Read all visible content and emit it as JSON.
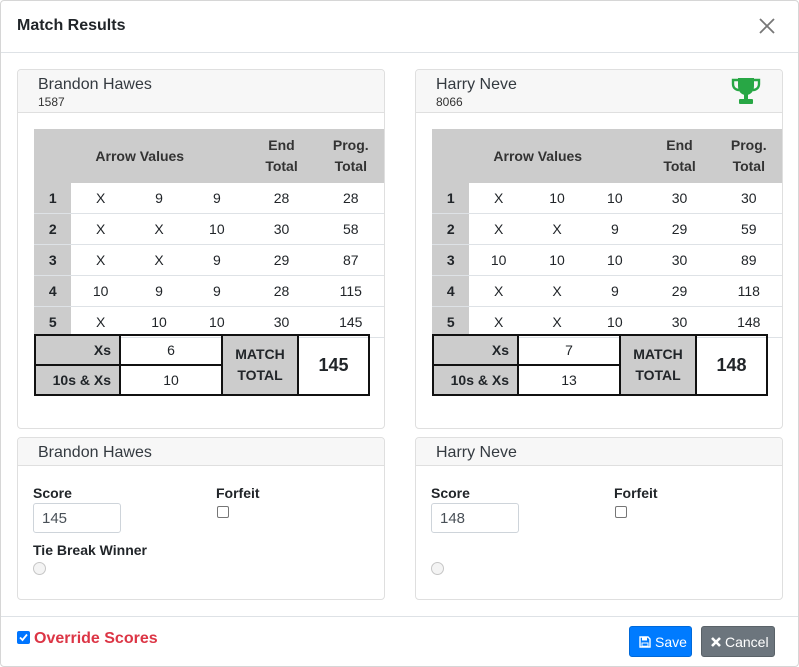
{
  "modal": {
    "title": "Match Results"
  },
  "scorecard_header": {
    "arrow_values": "Arrow Values",
    "end_total_1": "End",
    "end_total_2": "Total",
    "prog_total_1": "Prog.",
    "prog_total_2": "Total"
  },
  "summary_labels": {
    "xs": "Xs",
    "tens": "10s & Xs",
    "match_1": "MATCH",
    "match_2": "TOTAL"
  },
  "players": [
    {
      "name": "Brandon Hawes",
      "id": "1587",
      "winner": false,
      "ends": [
        {
          "n": "1",
          "a": [
            "X",
            "9",
            "9"
          ],
          "end": "28",
          "prog": "28"
        },
        {
          "n": "2",
          "a": [
            "X",
            "X",
            "10"
          ],
          "end": "30",
          "prog": "58"
        },
        {
          "n": "3",
          "a": [
            "X",
            "X",
            "9"
          ],
          "end": "29",
          "prog": "87"
        },
        {
          "n": "4",
          "a": [
            "10",
            "9",
            "9"
          ],
          "end": "28",
          "prog": "115"
        },
        {
          "n": "5",
          "a": [
            "X",
            "10",
            "10"
          ],
          "end": "30",
          "prog": "145"
        }
      ],
      "xs": "6",
      "tens": "10",
      "match_total": "145",
      "score": "145"
    },
    {
      "name": "Harry Neve",
      "id": "8066",
      "winner": true,
      "ends": [
        {
          "n": "1",
          "a": [
            "X",
            "10",
            "10"
          ],
          "end": "30",
          "prog": "30"
        },
        {
          "n": "2",
          "a": [
            "X",
            "X",
            "9"
          ],
          "end": "29",
          "prog": "59"
        },
        {
          "n": "3",
          "a": [
            "10",
            "10",
            "10"
          ],
          "end": "30",
          "prog": "89"
        },
        {
          "n": "4",
          "a": [
            "X",
            "X",
            "9"
          ],
          "end": "29",
          "prog": "118"
        },
        {
          "n": "5",
          "a": [
            "X",
            "X",
            "10"
          ],
          "end": "30",
          "prog": "148"
        }
      ],
      "xs": "7",
      "tens": "13",
      "match_total": "148",
      "score": "148"
    }
  ],
  "form": {
    "score_label": "Score",
    "forfeit_label": "Forfeit",
    "tie_break_label": "Tie Break Winner"
  },
  "footer": {
    "override_label": "Override Scores",
    "override_checked": true,
    "save_label": "Save",
    "cancel_label": "Cancel"
  },
  "colors": {
    "primary": "#007bff",
    "secondary": "#6c757d",
    "danger": "#dc3545",
    "trophy": "#28a745",
    "header_gray": "#cccccc"
  },
  "icons": {
    "close": "close-icon",
    "trophy": "trophy-icon",
    "save": "floppy-disk-icon",
    "cancel": "x-icon"
  }
}
